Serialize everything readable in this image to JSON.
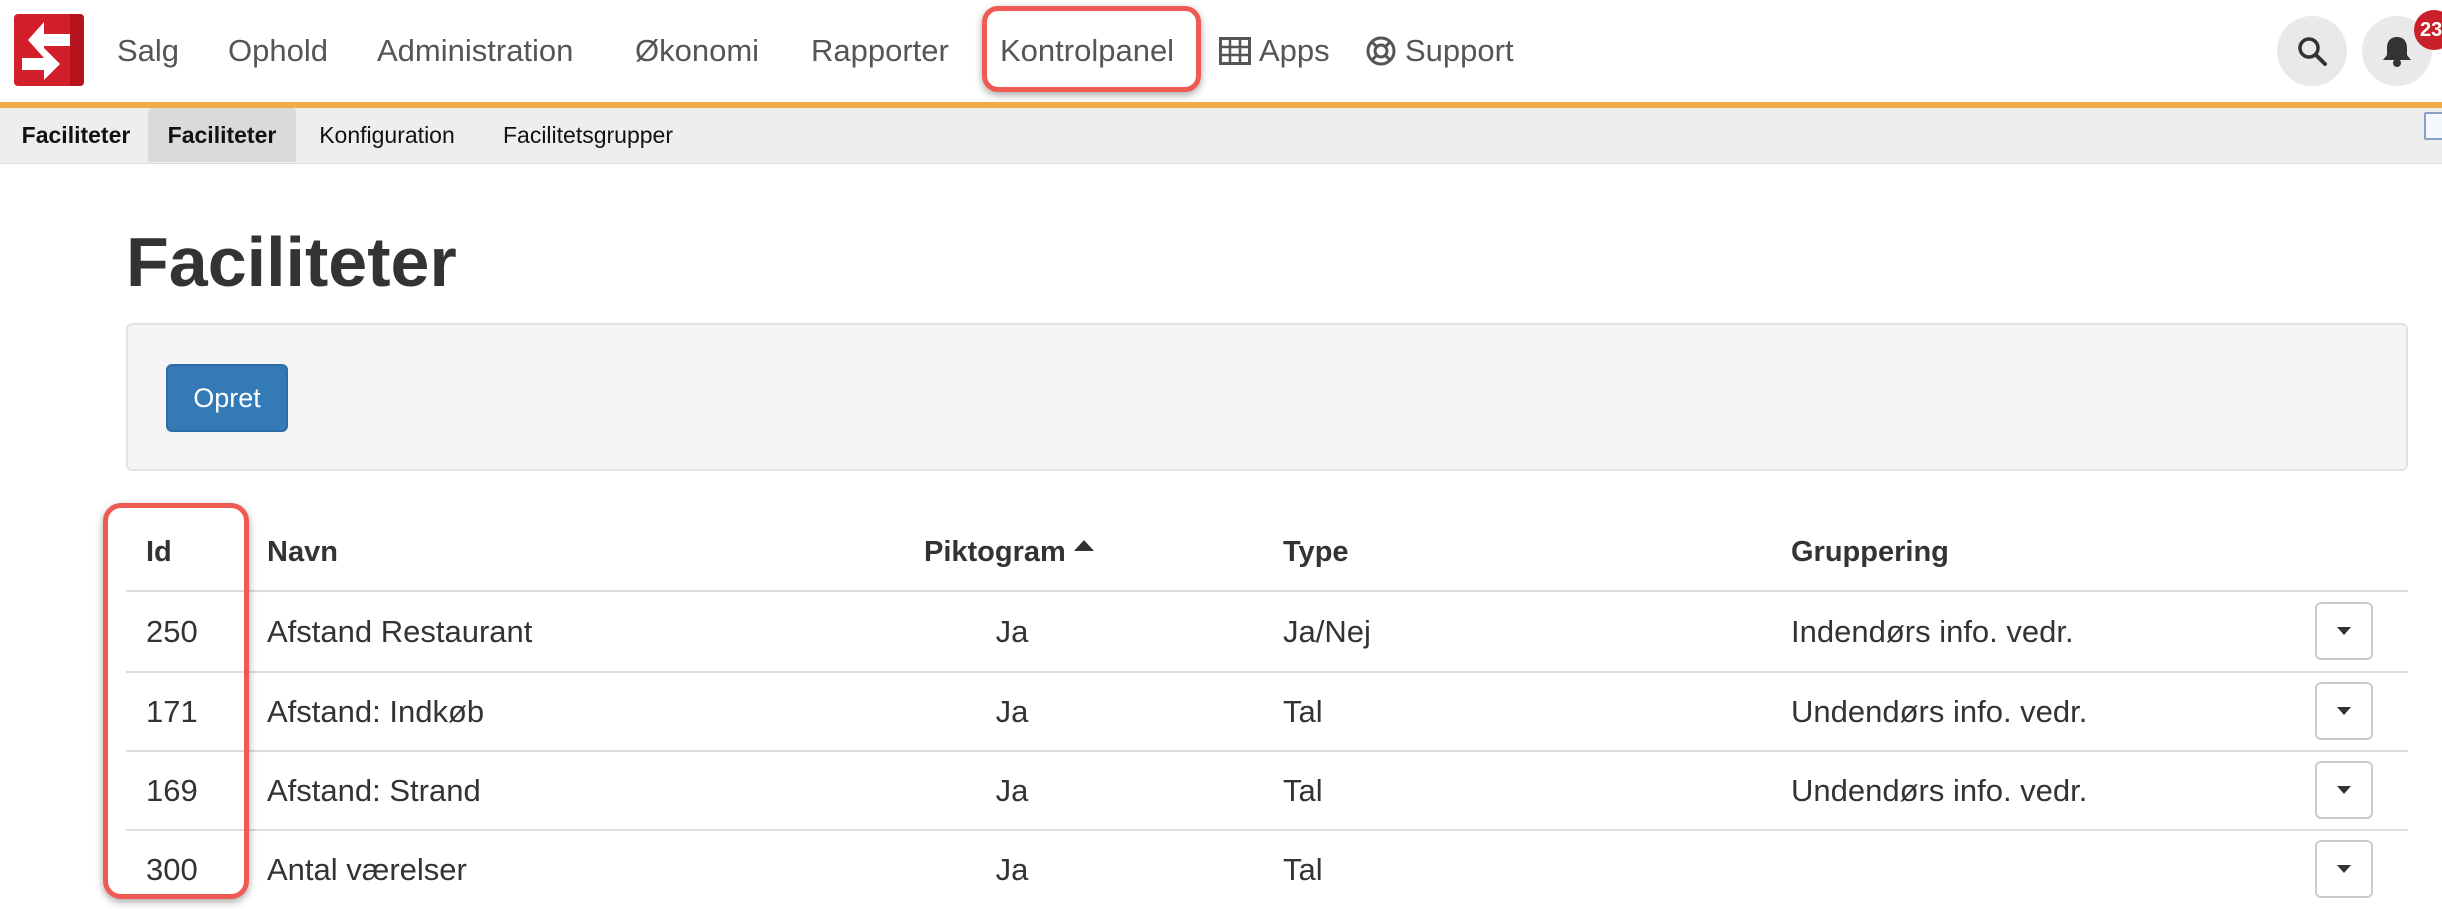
{
  "nav": {
    "items": [
      {
        "label": "Salg"
      },
      {
        "label": "Ophold"
      },
      {
        "label": "Administration"
      },
      {
        "label": "Økonomi"
      },
      {
        "label": "Rapporter"
      },
      {
        "label": "Kontrolpanel"
      },
      {
        "label": "Apps",
        "icon": "grid-icon"
      },
      {
        "label": "Support",
        "icon": "lifebuoy-icon"
      }
    ],
    "notification_count": "23",
    "colors": {
      "brand": "#d31f2b",
      "nav_border": "#f0ac45",
      "highlight": "#ef5a52"
    }
  },
  "subnav": {
    "items": [
      {
        "label": "Faciliteter"
      },
      {
        "label": "Faciliteter"
      },
      {
        "label": "Konfiguration"
      },
      {
        "label": "Facilitetsgrupper"
      }
    ]
  },
  "page": {
    "title": "Faciliteter",
    "create_label": "Opret"
  },
  "table": {
    "headers": {
      "id": "Id",
      "name": "Navn",
      "pictogram": "Piktogram",
      "type": "Type",
      "grouping": "Gruppering"
    },
    "rows": [
      {
        "id": "250",
        "name": "Afstand Restaurant",
        "pictogram": "Ja",
        "type": "Ja/Nej",
        "grouping": "Indendørs info. vedr."
      },
      {
        "id": "171",
        "name": "Afstand: Indkøb",
        "pictogram": "Ja",
        "type": "Tal",
        "grouping": "Undendørs info. vedr."
      },
      {
        "id": "169",
        "name": "Afstand: Strand",
        "pictogram": "Ja",
        "type": "Tal",
        "grouping": "Undendørs info. vedr."
      },
      {
        "id": "300",
        "name": "Antal værelser",
        "pictogram": "Ja",
        "type": "Tal",
        "grouping": ""
      }
    ]
  }
}
